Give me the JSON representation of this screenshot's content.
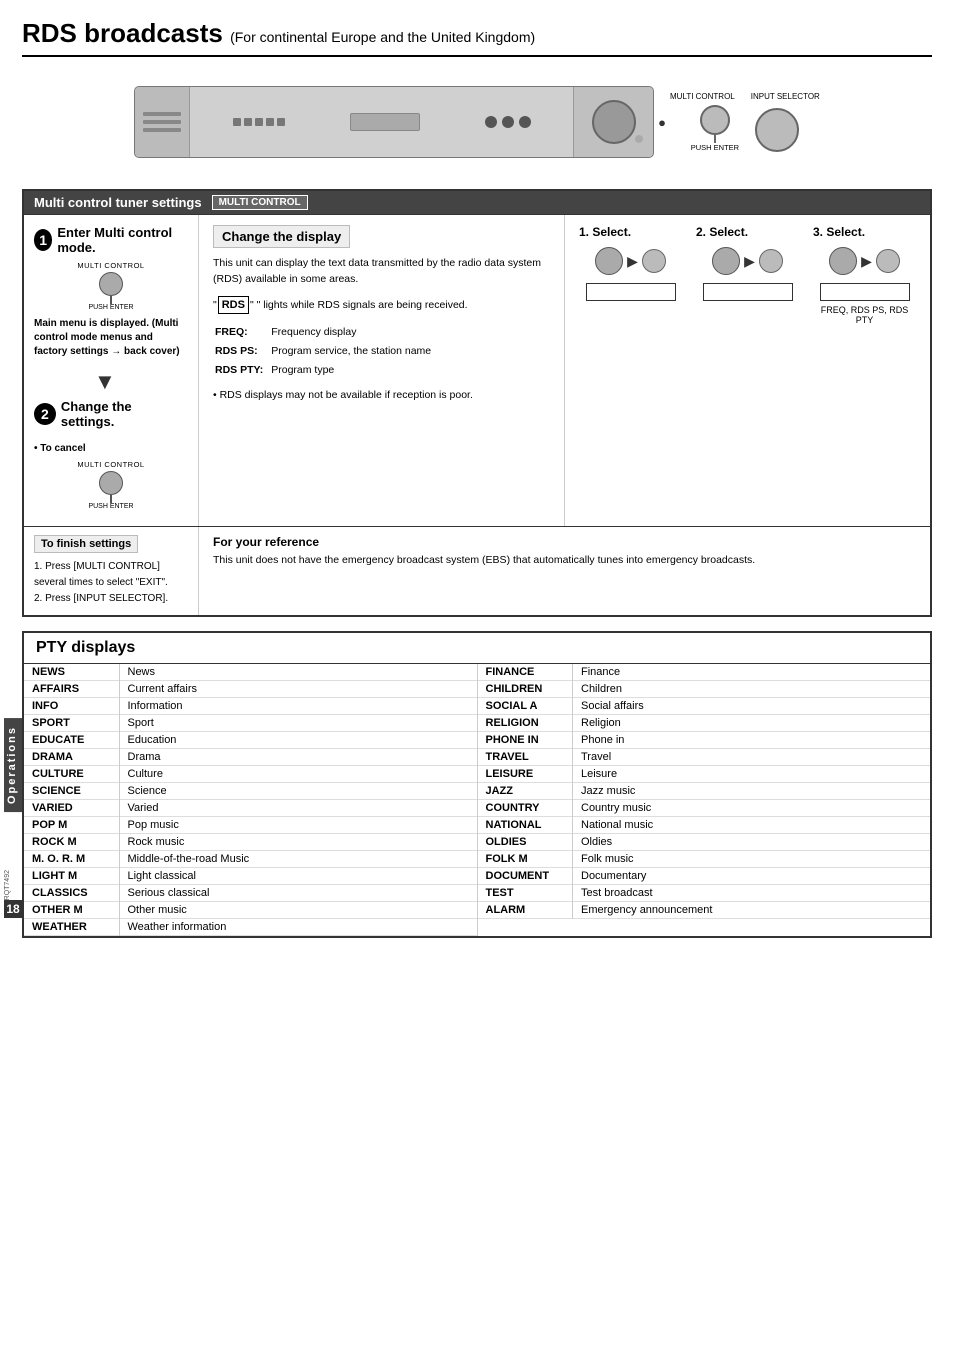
{
  "page": {
    "title": "RDS broadcasts",
    "subtitle": "(For continental Europe and the United Kingdom)"
  },
  "header_labels": {
    "multi_control": "MULTI CONTROL",
    "input_selector": "INPUT SELECTOR",
    "push_enter": "PUSH ENTER"
  },
  "main_section": {
    "title": "Multi control tuner settings",
    "badge": "MULTI CONTROL",
    "step1": {
      "title": "Enter Multi control mode.",
      "label": "MULTI CONTROL",
      "push_enter": "PUSH ENTER",
      "desc": "Main menu is displayed. (Multi control mode menus and factory settings → back cover)"
    },
    "step2": {
      "title": "Change the settings."
    },
    "cancel": {
      "label": "• To cancel",
      "multi_control": "MULTI CONTROL",
      "push_enter": "PUSH ENTER"
    }
  },
  "change_display": {
    "title": "Change the display",
    "text1": "This unit can display the text data transmitted by the radio data system (RDS) available in some areas.",
    "rds_badge": "RDS",
    "text2": "\" lights while RDS signals are being received.",
    "freq_rows": [
      {
        "key": "FREQ:",
        "value": "Frequency display"
      },
      {
        "key": "RDS PS:",
        "value": "Program service, the station name"
      },
      {
        "key": "RDS PTY:",
        "value": "Program type"
      }
    ],
    "bullet": "• RDS  displays may not be available if reception is poor."
  },
  "select_columns": [
    {
      "label": "1. Select."
    },
    {
      "label": "2. Select."
    },
    {
      "label": "3. Select.",
      "bottom_label": "FREQ, RDS PS, RDS PTY"
    }
  ],
  "finish_settings": {
    "title": "To finish settings",
    "steps": [
      "1. Press [MULTI  CONTROL] several  times  to  select \"EXIT\".",
      "2. Press [INPUT SELECTOR]."
    ]
  },
  "your_reference": {
    "title": "For your reference",
    "text": "This unit does not have the emergency broadcast system (EBS) that automatically tunes into emergency broadcasts."
  },
  "pty_section": {
    "title": "PTY displays",
    "left_rows": [
      {
        "code": "NEWS",
        "desc": "News"
      },
      {
        "code": "AFFAIRS",
        "desc": "Current affairs"
      },
      {
        "code": "INFO",
        "desc": "Information"
      },
      {
        "code": "SPORT",
        "desc": "Sport"
      },
      {
        "code": "EDUCATE",
        "desc": "Education"
      },
      {
        "code": "DRAMA",
        "desc": "Drama"
      },
      {
        "code": "CULTURE",
        "desc": "Culture"
      },
      {
        "code": "SCIENCE",
        "desc": "Science"
      },
      {
        "code": "VARIED",
        "desc": "Varied"
      },
      {
        "code": "POP M",
        "desc": "Pop music"
      },
      {
        "code": "ROCK M",
        "desc": "Rock music"
      },
      {
        "code": "M. O. R.  M",
        "desc": "Middle-of-the-road Music"
      },
      {
        "code": "LIGHT M",
        "desc": "Light classical"
      },
      {
        "code": "CLASSICS",
        "desc": "Serious classical"
      },
      {
        "code": "OTHER M",
        "desc": "Other music"
      },
      {
        "code": "WEATHER",
        "desc": "Weather information"
      }
    ],
    "right_rows": [
      {
        "code": "FINANCE",
        "desc": "Finance"
      },
      {
        "code": "CHILDREN",
        "desc": "Children"
      },
      {
        "code": "SOCIAL A",
        "desc": "Social affairs"
      },
      {
        "code": "RELIGION",
        "desc": "Religion"
      },
      {
        "code": "PHONE IN",
        "desc": "Phone in"
      },
      {
        "code": "TRAVEL",
        "desc": "Travel"
      },
      {
        "code": "LEISURE",
        "desc": "Leisure"
      },
      {
        "code": "JAZZ",
        "desc": "Jazz music"
      },
      {
        "code": "COUNTRY",
        "desc": "Country music"
      },
      {
        "code": "NATIONAL",
        "desc": "National music"
      },
      {
        "code": "OLDIES",
        "desc": "Oldies"
      },
      {
        "code": "FOLK M",
        "desc": "Folk music"
      },
      {
        "code": "DOCUMENT",
        "desc": "Documentary"
      },
      {
        "code": "TEST",
        "desc": "Test broadcast"
      },
      {
        "code": "ALARM",
        "desc": "Emergency announcement"
      }
    ]
  },
  "sidebar": {
    "label": "Operations"
  },
  "footer": {
    "rqt": "RQT7492",
    "page": "18"
  }
}
